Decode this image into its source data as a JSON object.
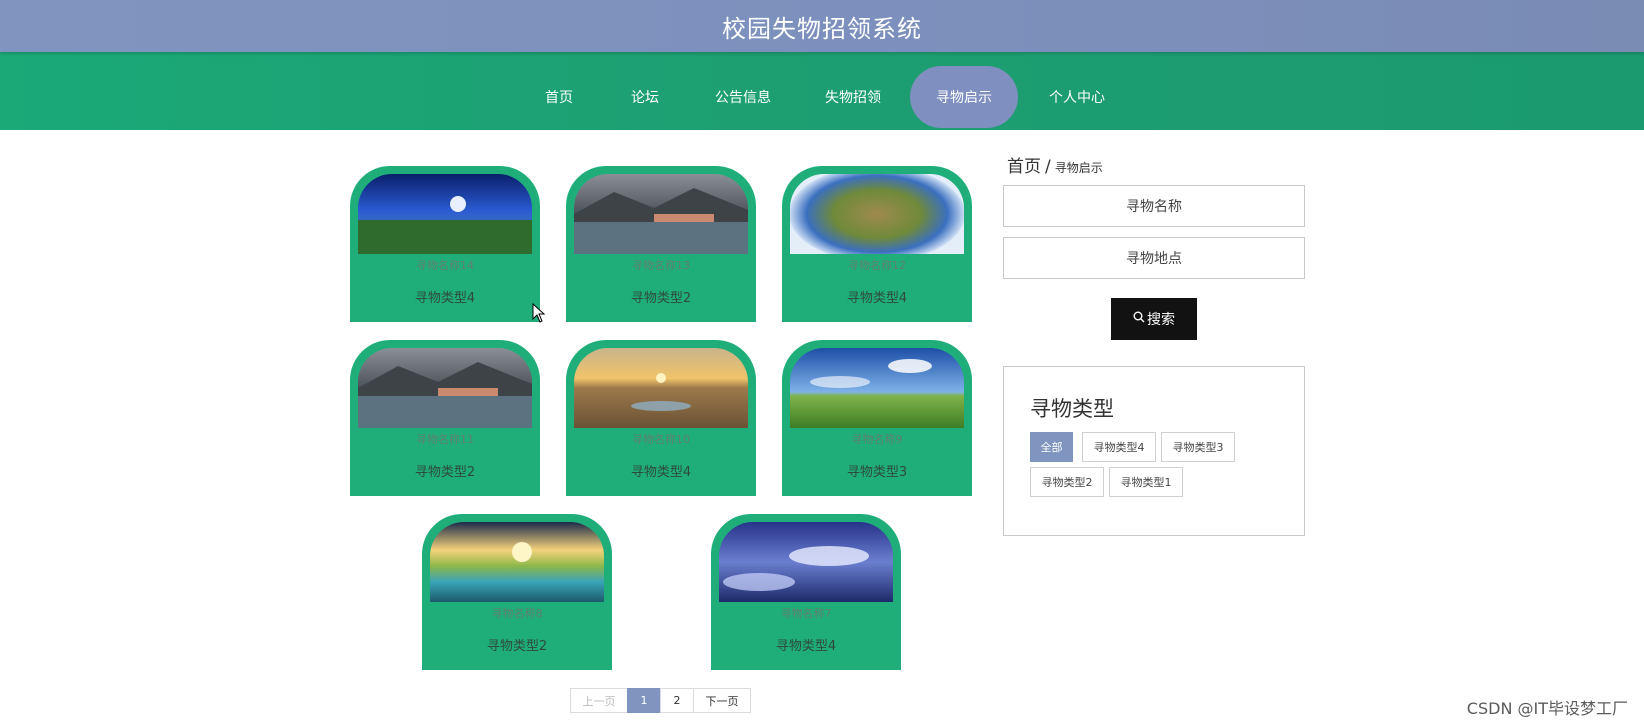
{
  "header": {
    "title": "校园失物招领系统"
  },
  "nav": {
    "items": [
      {
        "label": "首页"
      },
      {
        "label": "论坛"
      },
      {
        "label": "公告信息"
      },
      {
        "label": "失物招领"
      },
      {
        "label": "寻物启示"
      },
      {
        "label": "个人中心"
      }
    ],
    "active_index": 4
  },
  "cards": [
    {
      "name": "寻物名称14",
      "type": "寻物类型4",
      "image": "night-meadow-moon"
    },
    {
      "name": "寻物名称13",
      "type": "寻物类型2",
      "image": "lake-village"
    },
    {
      "name": "寻物名称12",
      "type": "寻物类型4",
      "image": "planet-sphere"
    },
    {
      "name": "寻物名称11",
      "type": "寻物类型2",
      "image": "lake-village"
    },
    {
      "name": "寻物名称10",
      "type": "寻物类型4",
      "image": "desert-sunset"
    },
    {
      "name": "寻物名称9",
      "type": "寻物类型3",
      "image": "green-hills"
    },
    {
      "name": "寻物名称8",
      "type": "寻物类型2",
      "image": "sunset-lake"
    },
    {
      "name": "寻物名称7",
      "type": "寻物类型4",
      "image": "cloud-sky"
    }
  ],
  "breadcrumb": {
    "home": "首页",
    "separator": "/",
    "current": "寻物启示"
  },
  "search": {
    "name_placeholder": "寻物名称",
    "location_placeholder": "寻物地点",
    "button_label": "搜索"
  },
  "categories": {
    "title": "寻物类型",
    "tags": [
      "全部",
      "寻物类型4",
      "寻物类型3",
      "寻物类型2",
      "寻物类型1"
    ],
    "active_index": 0
  },
  "pagination": {
    "prev": "上一页",
    "pages": [
      "1",
      "2"
    ],
    "current": "1",
    "next": "下一页"
  },
  "watermark": "CSDN @IT毕设梦工厂",
  "colors": {
    "header": "#7f95bf",
    "nav": "#1ba978",
    "card": "#1fae7a",
    "accent": "#7f95bf",
    "button": "#121212"
  }
}
